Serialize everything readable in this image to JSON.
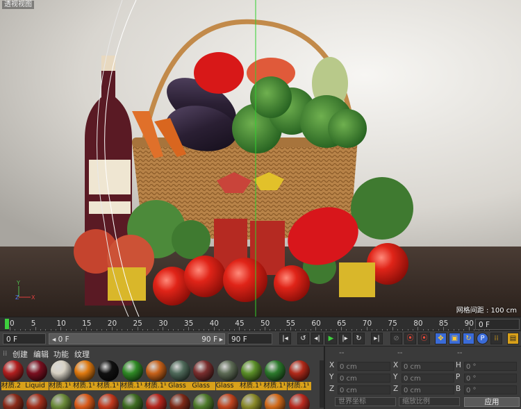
{
  "viewport": {
    "title": "透视视图",
    "grid_spacing": "网格间距 : 100 cm"
  },
  "timeline": {
    "ticks": [
      "0",
      "5",
      "10",
      "15",
      "20",
      "25",
      "30",
      "35",
      "40",
      "45",
      "50",
      "55",
      "60",
      "65",
      "70",
      "75",
      "80",
      "85",
      "90"
    ],
    "end_field": "0 F"
  },
  "transport": {
    "start_frame": "0 F",
    "range_start": "0 F",
    "range_end": "90 F",
    "max_frame": "90 F"
  },
  "materials": {
    "menu": [
      "创建",
      "编辑",
      "功能",
      "纹理"
    ],
    "items": [
      {
        "label": "材质.2",
        "color": "#b11f1f"
      },
      {
        "label": "Liquid",
        "color": "#7a1020"
      },
      {
        "label": "材质.1¹",
        "color": "#d8d2c4"
      },
      {
        "label": "材质.1¹",
        "color": "#e07a10"
      },
      {
        "label": "材质.1¹",
        "color": "#111111"
      },
      {
        "label": "材质.1¹",
        "color": "#2f8a25"
      },
      {
        "label": "材质.1¹",
        "color": "#c8621a"
      },
      {
        "label": "Glass",
        "color": "#4f6a5a"
      },
      {
        "label": "Glass",
        "color": "#7a2e2e"
      },
      {
        "label": "Glass",
        "color": "#5d6b55"
      },
      {
        "label": "材质.1¹",
        "color": "#5b8f28"
      },
      {
        "label": "材质.1¹",
        "color": "#2c7a2c"
      },
      {
        "label": "材质.1¹",
        "color": "#b12a1a"
      }
    ],
    "row2_colors": [
      "#8a2b1a",
      "#a3301c",
      "#6b8a3a",
      "#d95a1a",
      "#c43a1e",
      "#3f6b22",
      "#b5261d",
      "#7e2a18",
      "#4f7a2b",
      "#c2451f",
      "#8a8a2a",
      "#d26a1a",
      "#bb2b20"
    ]
  },
  "attributes": {
    "headers": [
      "--",
      "--",
      "--"
    ],
    "rows": [
      {
        "a": "X",
        "av": "0 cm",
        "b": "X",
        "bv": "0 cm",
        "c": "H",
        "cv": "0 °"
      },
      {
        "a": "Y",
        "av": "0 cm",
        "b": "Y",
        "bv": "0 cm",
        "c": "P",
        "cv": "0 °"
      },
      {
        "a": "Z",
        "av": "0 cm",
        "b": "Z",
        "bv": "0 cm",
        "c": "B",
        "cv": "0 °"
      }
    ],
    "coord_dropdown": "世界坐标",
    "scale_dropdown": "缩放比例",
    "apply_label": "应用"
  }
}
